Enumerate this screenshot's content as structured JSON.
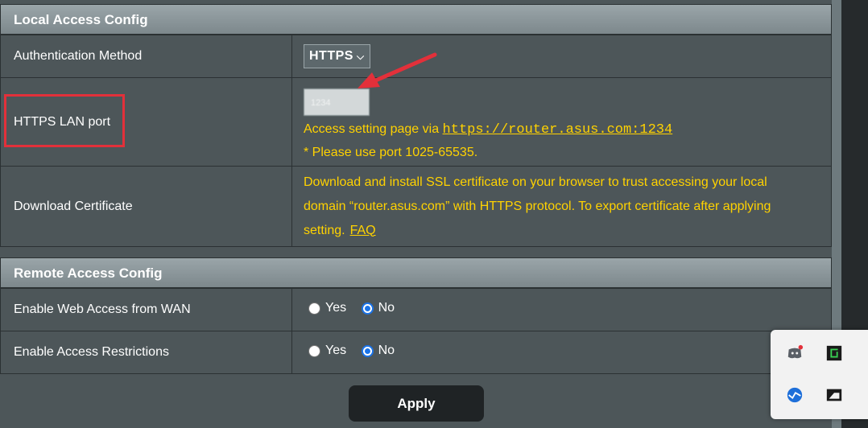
{
  "local": {
    "title": "Local Access Config",
    "auth_label": "Authentication Method",
    "auth_value": "HTTPS",
    "port_label": "HTTPS LAN port",
    "port_value": "1234",
    "access_prefix": "Access setting page via",
    "access_url": "https://router.asus.com:1234",
    "port_hint": "* Please use port 1025-65535.",
    "cert_label": "Download Certificate",
    "cert_line1": "Download and install SSL certificate on your browser to trust accessing your local",
    "cert_line2": "domain “router.asus.com” with HTTPS protocol. To export certificate after applying",
    "cert_line3": "setting.",
    "faq": "FAQ"
  },
  "remote": {
    "title": "Remote Access Config",
    "wan_label": "Enable Web Access from WAN",
    "restrict_label": "Enable Access Restrictions",
    "yes": "Yes",
    "no": "No",
    "wan_selected": "No",
    "restrict_selected": "No"
  },
  "apply_label": "Apply",
  "tray": {
    "icons": [
      "discord-icon",
      "terminal-icon",
      "network-icon",
      "display-icon"
    ]
  },
  "colors": {
    "accent_yellow": "#ffd200",
    "highlight_red": "#e3303a",
    "radio_blue": "#1a73e8"
  }
}
